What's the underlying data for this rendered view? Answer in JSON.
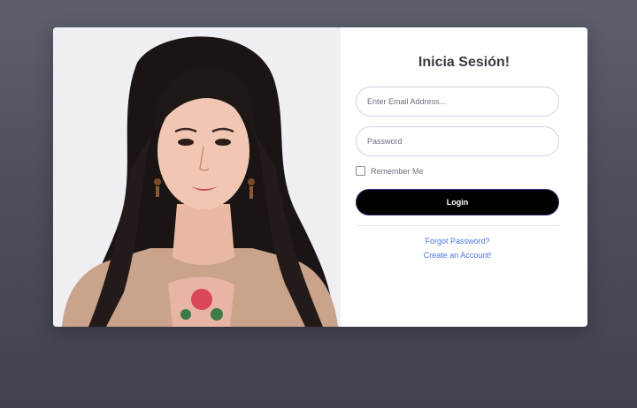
{
  "login": {
    "title": "Inicia Sesión!",
    "email_placeholder": "Enter Email Address...",
    "password_placeholder": "Password",
    "remember_label": "Remember Me",
    "login_label": "Login",
    "forgot_link": "Forgot Password?",
    "create_link": "Create an Account!"
  },
  "colors": {
    "page_background": "#4d4f5c",
    "card_background": "#ffffff",
    "button_background": "#000000",
    "link": "#4e73df"
  },
  "image": {
    "icon": "portrait-photo"
  }
}
